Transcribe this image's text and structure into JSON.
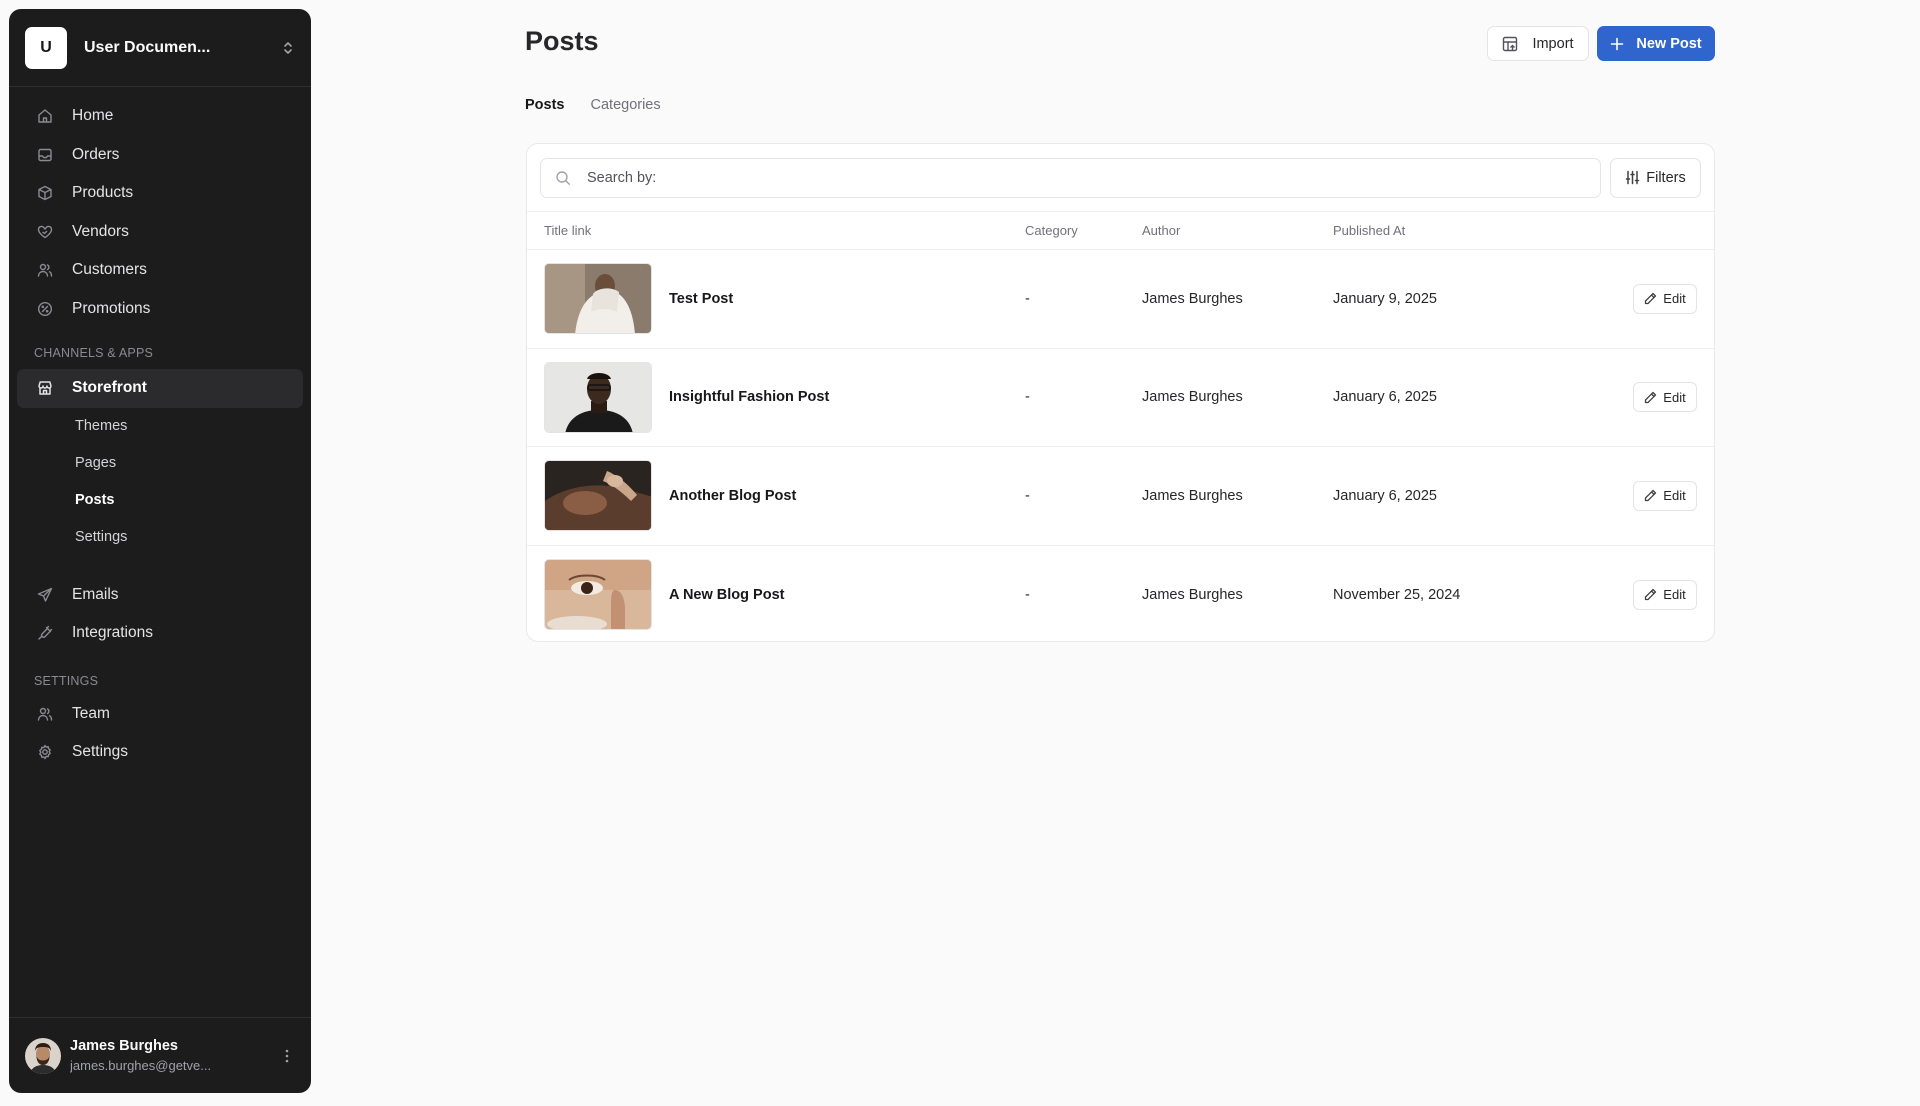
{
  "workspace": {
    "initial": "U",
    "name": "User Documen..."
  },
  "nav": {
    "main": [
      {
        "label": "Home",
        "icon": "home-icon"
      },
      {
        "label": "Orders",
        "icon": "inbox-icon"
      },
      {
        "label": "Products",
        "icon": "box-icon"
      },
      {
        "label": "Vendors",
        "icon": "handshake-icon"
      },
      {
        "label": "Customers",
        "icon": "users-icon"
      },
      {
        "label": "Promotions",
        "icon": "percent-icon"
      }
    ],
    "channels_label": "CHANNELS & APPS",
    "storefront": {
      "label": "Storefront",
      "icon": "store-icon"
    },
    "storefront_sub": [
      {
        "label": "Themes"
      },
      {
        "label": "Pages"
      },
      {
        "label": "Posts"
      },
      {
        "label": "Settings"
      }
    ],
    "extra": [
      {
        "label": "Emails",
        "icon": "send-icon"
      },
      {
        "label": "Integrations",
        "icon": "plug-icon"
      }
    ],
    "settings_label": "SETTINGS",
    "settings": [
      {
        "label": "Team",
        "icon": "users-icon"
      },
      {
        "label": "Settings",
        "icon": "gear-icon"
      }
    ]
  },
  "user": {
    "name": "James Burghes",
    "email": "james.burghes@getve..."
  },
  "page": {
    "title": "Posts",
    "import_label": "Import",
    "new_label": "New Post",
    "tabs": [
      "Posts",
      "Categories"
    ]
  },
  "search": {
    "placeholder": "Search by:",
    "filters_label": "Filters"
  },
  "table": {
    "columns": [
      "Title link",
      "Category",
      "Author",
      "Published At"
    ],
    "edit_label": "Edit",
    "rows": [
      {
        "title": "Test Post",
        "category": "-",
        "author": "James Burghes",
        "published": "January 9, 2025"
      },
      {
        "title": "Insightful Fashion Post",
        "category": "-",
        "author": "James Burghes",
        "published": "January 6, 2025"
      },
      {
        "title": "Another Blog Post",
        "category": "-",
        "author": "James Burghes",
        "published": "January 6, 2025"
      },
      {
        "title": "A New Blog Post",
        "category": "-",
        "author": "James Burghes",
        "published": "November 25, 2024"
      }
    ]
  },
  "colors": {
    "primary": "#2f65cc",
    "sidebar_bg": "#1c1c1c",
    "page_bg": "#fafafa"
  }
}
